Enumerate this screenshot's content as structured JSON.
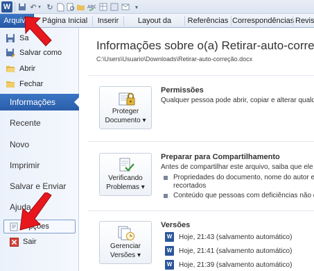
{
  "quick_access": {
    "logo": "W"
  },
  "tabs": [
    {
      "label": "Arquivo"
    },
    {
      "label": "Página Inicial"
    },
    {
      "label": "Inserir"
    },
    {
      "label": "Layout da Página"
    },
    {
      "label": "Referências"
    },
    {
      "label": "Correspondências"
    },
    {
      "label": "Revisão"
    }
  ],
  "sidebar": {
    "commands": [
      {
        "label": "Sa",
        "icon": "save-icon"
      },
      {
        "label": "Salvar como",
        "icon": "save-as-icon"
      },
      {
        "label": "Abrir",
        "icon": "open-folder-icon"
      },
      {
        "label": "Fechar",
        "icon": "close-folder-icon"
      }
    ],
    "items": [
      {
        "label": "Informações",
        "active": true
      },
      {
        "label": "Recente"
      },
      {
        "label": "Novo"
      },
      {
        "label": "Imprimir"
      },
      {
        "label": "Salvar e Enviar"
      },
      {
        "label": "Ajuda"
      }
    ],
    "options_label": "Opções",
    "exit_label": "Sair"
  },
  "main": {
    "title": "Informações sobre o(a) Retirar-auto-correç",
    "path": "C:\\Users\\Usuario\\Downloads\\Retirar-auto-correção.docx",
    "sections": [
      {
        "button_line1": "Proteger",
        "button_line2": "Documento ▾",
        "heading": "Permissões",
        "text": "Qualquer pessoa pode abrir, copiar e alterar qualquer"
      },
      {
        "button_line1": "Verificando",
        "button_line2": "Problemas ▾",
        "heading": "Preparar para Compartilhamento",
        "text": "Antes de compartilhar este arquivo, saiba que ele con",
        "bullets": [
          {
            "line1": "Propriedades do documento, nome do autor e",
            "line2": "recortados"
          },
          {
            "line1": "Conteúdo que pessoas com deficiências não con"
          }
        ]
      },
      {
        "button_line1": "Gerenciar",
        "button_line2": "Versões ▾",
        "heading": "Versões",
        "versions": [
          "Hoje, 21:43 (salvamento automático)",
          "Hoje, 21:41 (salvamento automático)",
          "Hoje, 21:39 (salvamento automático)"
        ]
      }
    ]
  },
  "colors": {
    "accent": "#2a5ea9",
    "arrow": "#e8171e"
  }
}
